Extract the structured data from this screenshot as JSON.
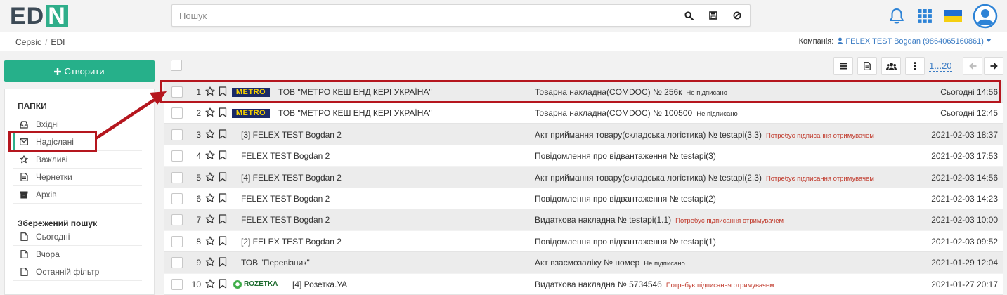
{
  "app": {
    "logo_text": "EDI",
    "logo_prefix": "ED",
    "logo_last": "N"
  },
  "search": {
    "placeholder": "Пошук"
  },
  "icons": {
    "search": "search-icon",
    "save": "floppy-icon",
    "clear": "ban-icon",
    "bell": "bell-icon",
    "apps": "grid-icon",
    "flag": "ukraine-flag-icon",
    "profile": "user-avatar-icon"
  },
  "breadcrumb": {
    "items": [
      "Сервіс",
      "EDI"
    ],
    "separator": "/"
  },
  "company": {
    "label": "Компанія:",
    "value": "FELEX TEST Bogdan (9864065160861)"
  },
  "sidebar": {
    "create_label": "Створити",
    "folders_title": "ПАПКИ",
    "folders": [
      {
        "label": "Вхідні",
        "icon": "inbox-icon"
      },
      {
        "label": "Надіслані",
        "icon": "envelope-icon",
        "active": true
      },
      {
        "label": "Важливі",
        "icon": "star-icon"
      },
      {
        "label": "Чернетки",
        "icon": "draft-icon"
      },
      {
        "label": "Архів",
        "icon": "archive-icon"
      }
    ],
    "saved_title": "Збережений пошук",
    "saved": [
      {
        "label": "Сьогодні",
        "icon": "doc-icon"
      },
      {
        "label": "Вчора",
        "icon": "doc-icon"
      },
      {
        "label": "Останній фільтр",
        "icon": "doc-icon"
      }
    ]
  },
  "toolbar": {
    "pager": "1...20"
  },
  "brands": {
    "metro": "METRO",
    "rozetka": "ROZETKA"
  },
  "rows": [
    {
      "num": "1",
      "logo": "metro",
      "sender": "ТОВ \"МЕТРО КЕШ ЕНД КЕРІ УКРАЇНА\"",
      "doc": "Товарна накладна(COMDOC) № 256к",
      "status": "Не підписано",
      "status_type": "unsigned",
      "date": "Сьогодні 14:56"
    },
    {
      "num": "2",
      "logo": "metro",
      "sender": "ТОВ \"МЕТРО КЕШ ЕНД КЕРІ УКРАЇНА\"",
      "doc": "Товарна накладна(COMDOC) № 100500",
      "status": "Не підписано",
      "status_type": "unsigned",
      "date": "Сьогодні 12:45"
    },
    {
      "num": "3",
      "logo": "",
      "sender": "[3] FELEX TEST Bogdan 2",
      "doc": "Акт приймання товару(складська логістика) № testapi(3.3)",
      "status": "Потребує підписання отримувачем",
      "status_type": "need",
      "date": "2021-02-03 18:37"
    },
    {
      "num": "4",
      "logo": "",
      "sender": "FELEX TEST Bogdan 2",
      "doc": "Повідомлення про відвантаження № testapi(3)",
      "status": "",
      "status_type": "",
      "date": "2021-02-03 17:53"
    },
    {
      "num": "5",
      "logo": "",
      "sender": "[4] FELEX TEST Bogdan 2",
      "doc": "Акт приймання товару(складська логістика) № testapi(2.3)",
      "status": "Потребує підписання отримувачем",
      "status_type": "need",
      "date": "2021-02-03 14:56"
    },
    {
      "num": "6",
      "logo": "",
      "sender": "FELEX TEST Bogdan 2",
      "doc": "Повідомлення про відвантаження № testapi(2)",
      "status": "",
      "status_type": "",
      "date": "2021-02-03 14:23"
    },
    {
      "num": "7",
      "logo": "",
      "sender": "FELEX TEST Bogdan 2",
      "doc": "Видаткова накладна № testapi(1.1)",
      "status": "Потребує підписання отримувачем",
      "status_type": "need",
      "date": "2021-02-03 10:00"
    },
    {
      "num": "8",
      "logo": "",
      "sender": "[2] FELEX TEST Bogdan 2",
      "doc": "Повідомлення про відвантаження № testapi(1)",
      "status": "",
      "status_type": "",
      "date": "2021-02-03 09:52"
    },
    {
      "num": "9",
      "logo": "",
      "sender": "ТОВ \"Перевізник\"",
      "doc": "Акт взаємозаліку № номер",
      "status": "Не підписано",
      "status_type": "unsigned",
      "date": "2021-01-29 12:04"
    },
    {
      "num": "10",
      "logo": "rozetka",
      "sender": "[4] Розетка.УА",
      "doc": "Видаткова накладна № 5734546",
      "status": "Потребує підписання отримувачем",
      "status_type": "need",
      "date": "2021-01-27 20:17"
    }
  ],
  "colors": {
    "accent": "#26b08a",
    "highlight": "#b5161e",
    "link": "#3b7cc4"
  }
}
